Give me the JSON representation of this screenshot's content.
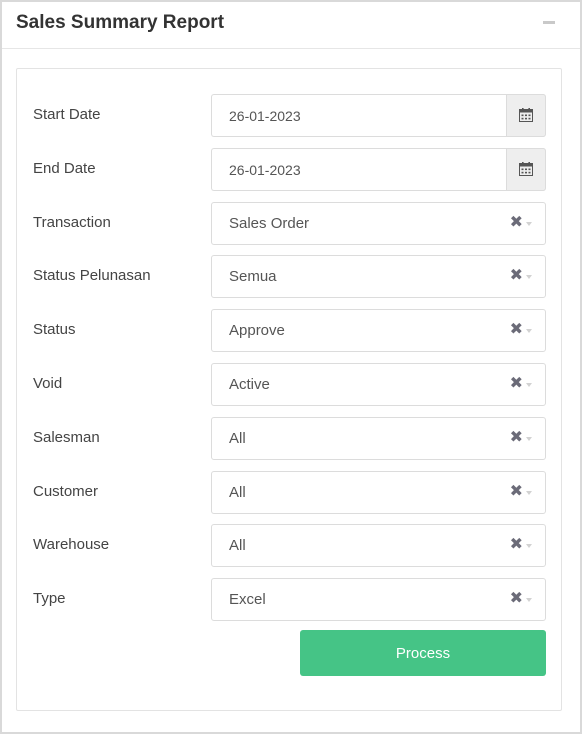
{
  "panel": {
    "title": "Sales Summary Report"
  },
  "form": {
    "start_date": {
      "label": "Start Date",
      "value": "26-01-2023"
    },
    "end_date": {
      "label": "End Date",
      "value": "26-01-2023"
    },
    "transaction": {
      "label": "Transaction",
      "value": "Sales Order"
    },
    "status_pelunasan": {
      "label": "Status Pelunasan",
      "value": "Semua"
    },
    "status": {
      "label": "Status",
      "value": "Approve"
    },
    "void": {
      "label": "Void",
      "value": "Active"
    },
    "salesman": {
      "label": "Salesman",
      "value": "All"
    },
    "customer": {
      "label": "Customer",
      "value": "All"
    },
    "warehouse": {
      "label": "Warehouse",
      "value": "All"
    },
    "type": {
      "label": "Type",
      "value": "Excel"
    },
    "clear_glyph": "✖",
    "process_label": "Process"
  },
  "colors": {
    "accent": "#45c486",
    "clear_icon": "#6b6b78"
  }
}
